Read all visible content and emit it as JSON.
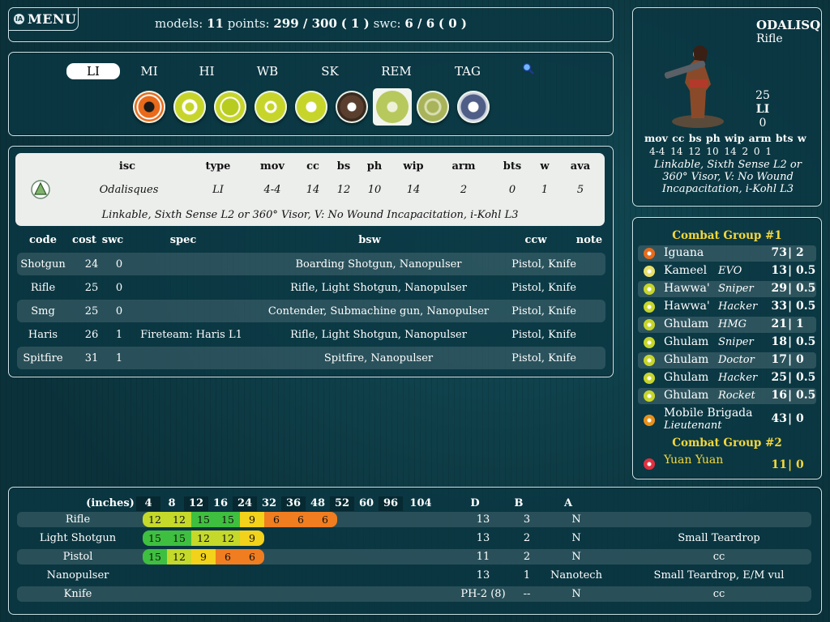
{
  "header": {
    "menu_label": "MENU",
    "logo_text": "IA",
    "models_label": "models:",
    "models": "11",
    "points_label": "points:",
    "points": "299 / 300",
    "points_extra": "( 1 )",
    "swc_label": "swc:",
    "swc": "6 / 6",
    "swc_extra": "( 0 )"
  },
  "tabs": [
    "LI",
    "MI",
    "HI",
    "WB",
    "SK",
    "REM",
    "TAG"
  ],
  "active_tab": "LI",
  "unit_icons": [
    {
      "name": "iguana-icon",
      "color": "#e86a1a"
    },
    {
      "name": "kameel-icon",
      "color": "#c7d52a"
    },
    {
      "name": "hawwa-icon",
      "color": "#c7d52a"
    },
    {
      "name": "ghulam-icon",
      "color": "#c7d52a"
    },
    {
      "name": "mobile-brigada-icon",
      "color": "#c7d52a"
    },
    {
      "name": "fiday-icon",
      "color": "#5a3f2e"
    },
    {
      "name": "odalisques-icon",
      "color": "#b7c95d"
    },
    {
      "name": "naffatun-icon",
      "color": "#a9b45a"
    },
    {
      "name": "tarik-icon",
      "color": "#4f5e86"
    }
  ],
  "unit_table": {
    "headers": [
      "isc",
      "type",
      "mov",
      "cc",
      "bs",
      "ph",
      "wip",
      "arm",
      "bts",
      "w",
      "ava"
    ],
    "values": [
      "Odalisques",
      "LI",
      "4-4",
      "14",
      "12",
      "10",
      "14",
      "2",
      "0",
      "1",
      "5"
    ],
    "notes": "Linkable, Sixth Sense L2 or 360° Visor, V: No Wound Incapacitation, i-Kohl L3"
  },
  "option_headers": [
    "code",
    "cost",
    "swc",
    "spec",
    "bsw",
    "ccw",
    "note"
  ],
  "options": [
    {
      "code": "Shotgun",
      "cost": "24",
      "swc": "0",
      "spec": "",
      "bsw": "Boarding Shotgun, Nanopulser",
      "ccw": "Pistol, Knife",
      "note": ""
    },
    {
      "code": "Rifle",
      "cost": "25",
      "swc": "0",
      "spec": "",
      "bsw": "Rifle, Light Shotgun, Nanopulser",
      "ccw": "Pistol, Knife",
      "note": ""
    },
    {
      "code": "Smg",
      "cost": "25",
      "swc": "0",
      "spec": "",
      "bsw": "Contender, Submachine gun, Nanopulser",
      "ccw": "Pistol, Knife",
      "note": ""
    },
    {
      "code": "Haris",
      "cost": "26",
      "swc": "1",
      "spec": "Fireteam: Haris L1",
      "bsw": "Rifle, Light Shotgun, Nanopulser",
      "ccw": "Pistol, Knife",
      "note": ""
    },
    {
      "code": "Spitfire",
      "cost": "31",
      "swc": "1",
      "spec": "",
      "bsw": "Spitfire, Nanopulser",
      "ccw": "Pistol, Knife",
      "note": ""
    }
  ],
  "detail": {
    "name": "ODALISQ",
    "option": "Rifle",
    "cost": "25",
    "type": "LI",
    "swc": "0",
    "stat_headers": "mov cc bs ph wip arm bts w",
    "stat_values": "4-4 14 12 10 14 2 0 1",
    "notes": "Linkable, Sixth Sense L2 or 360° Visor, V: No Wound Incapacitation, i-Kohl L3"
  },
  "army": {
    "group1_title": "Combat Group #1",
    "group2_title": "Combat Group #2",
    "rows": [
      {
        "name": "Iguana",
        "option": "",
        "cost": "73",
        "swc": "2",
        "icon_color": "#e86a1a"
      },
      {
        "name": "Kameel",
        "option": "EVO",
        "cost": "13",
        "swc": "0.5",
        "icon_color": "#e8e06a"
      },
      {
        "name": "Hawwa'",
        "option": "Sniper",
        "cost": "29",
        "swc": "0.5",
        "icon_color": "#c7d52a"
      },
      {
        "name": "Hawwa'",
        "option": "Hacker",
        "cost": "33",
        "swc": "0.5",
        "icon_color": "#c7d52a"
      },
      {
        "name": "Ghulam",
        "option": "HMG",
        "cost": "21",
        "swc": "1",
        "icon_color": "#c7d52a"
      },
      {
        "name": "Ghulam",
        "option": "Sniper",
        "cost": "18",
        "swc": "0.5",
        "icon_color": "#c7d52a"
      },
      {
        "name": "Ghulam",
        "option": "Doctor",
        "cost": "17",
        "swc": "0",
        "icon_color": "#c7d52a"
      },
      {
        "name": "Ghulam",
        "option": "Hacker",
        "cost": "25",
        "swc": "0.5",
        "icon_color": "#c7d52a"
      },
      {
        "name": "Ghulam",
        "option": "Rocket",
        "cost": "16",
        "swc": "0.5",
        "icon_color": "#c7d52a"
      }
    ],
    "brigada": {
      "name": "Mobile Brigada",
      "option": "Lieutenant",
      "cost": "43",
      "swc": "0",
      "icon_color": "#e8901a"
    },
    "group2_first": {
      "name": "Yuan Yuan",
      "cost": "11",
      "swc": "0",
      "icon_color": "#e03040"
    }
  },
  "ranges": {
    "inches_label": "(inches)",
    "distances": [
      "4",
      "8",
      "12",
      "16",
      "24",
      "32",
      "36",
      "48",
      "52",
      "60",
      "96",
      "104"
    ],
    "col_d": "D",
    "col_b": "B",
    "col_a": "A",
    "weapons": [
      {
        "name": "Rifle",
        "mods": [
          "12",
          "12",
          "15",
          "15",
          "9",
          "6",
          "6",
          "6"
        ],
        "d": "13",
        "b": "3",
        "a": "N",
        "special": ""
      },
      {
        "name": "Light Shotgun",
        "mods": [
          "15",
          "15",
          "12",
          "12",
          "9"
        ],
        "d": "13",
        "b": "2",
        "a": "N",
        "special": "Small Teardrop"
      },
      {
        "name": "Pistol",
        "mods": [
          "15",
          "12",
          "9",
          "6",
          "6"
        ],
        "d": "11",
        "b": "2",
        "a": "N",
        "special": "cc"
      },
      {
        "name": "Nanopulser",
        "mods": [],
        "d": "13",
        "b": "1",
        "a": "Nanotech",
        "special": "Small Teardrop, E/M vul"
      },
      {
        "name": "Knife",
        "mods": [],
        "d": "PH-2 (8)",
        "b": "--",
        "a": "N",
        "special": "cc"
      }
    ],
    "mod_colors": {
      "15": "#3fbf3f",
      "12": "#c4d92a",
      "9": "#f2d21a",
      "6": "#f07d20"
    }
  }
}
